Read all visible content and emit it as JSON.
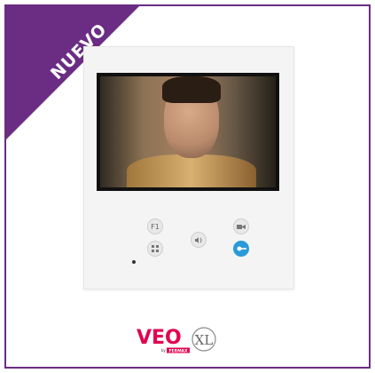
{
  "badge": {
    "label": "NUEVO"
  },
  "device": {
    "buttons": [
      {
        "id": "f1",
        "label": "F1"
      },
      {
        "id": "menu",
        "icon": "grid-icon"
      },
      {
        "id": "talk",
        "icon": "speaker-icon"
      },
      {
        "id": "camera",
        "icon": "camera-icon"
      },
      {
        "id": "door",
        "icon": "key-icon"
      }
    ]
  },
  "logo": {
    "brand": "VEO",
    "suffix": "XL",
    "maker": "FERMAX",
    "by": "by"
  },
  "colors": {
    "brand": "#6b2d83",
    "accent_blue": "#2a9bd8",
    "logo_red": "#e3004f"
  }
}
